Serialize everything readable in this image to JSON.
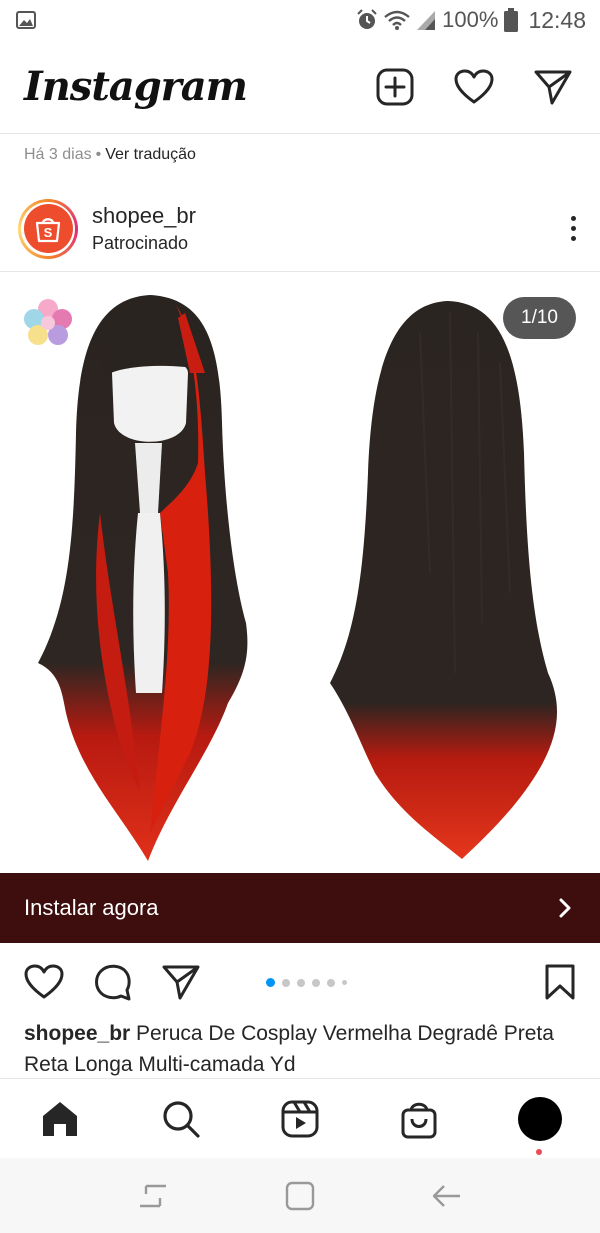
{
  "status_bar": {
    "battery": "100%",
    "time": "12:48"
  },
  "app": {
    "logo": "Instagram"
  },
  "previous_post": {
    "time_ago": "Há 3 dias",
    "separator": "•",
    "translate_link": "Ver tradução"
  },
  "post": {
    "username": "shopee_br",
    "subtitle": "Patrocinado",
    "media_counter": "1/10",
    "cta_label": "Instalar agora",
    "carousel": {
      "total_dots": 5,
      "active_index": 0
    },
    "caption_user": "shopee_br",
    "caption_text": " Peruca De Cosplay Vermelha Degradê Preta Reta Longa Multi-camada Yd"
  },
  "colors": {
    "cta_background": "#3e0e0e",
    "shopee_orange": "#ee4d2d",
    "active_dot": "#0095f6",
    "notification_dot": "#ed4956"
  },
  "icons": [
    "gallery-icon",
    "alarm-icon",
    "wifi-icon",
    "signal-icon",
    "battery-icon",
    "new-post-icon",
    "heart-icon",
    "direct-icon",
    "more-icon",
    "comment-icon",
    "share-icon",
    "bookmark-icon",
    "home-icon",
    "search-icon",
    "reels-icon",
    "shop-icon",
    "profile-icon",
    "recents-icon",
    "home-key-icon",
    "back-icon"
  ]
}
